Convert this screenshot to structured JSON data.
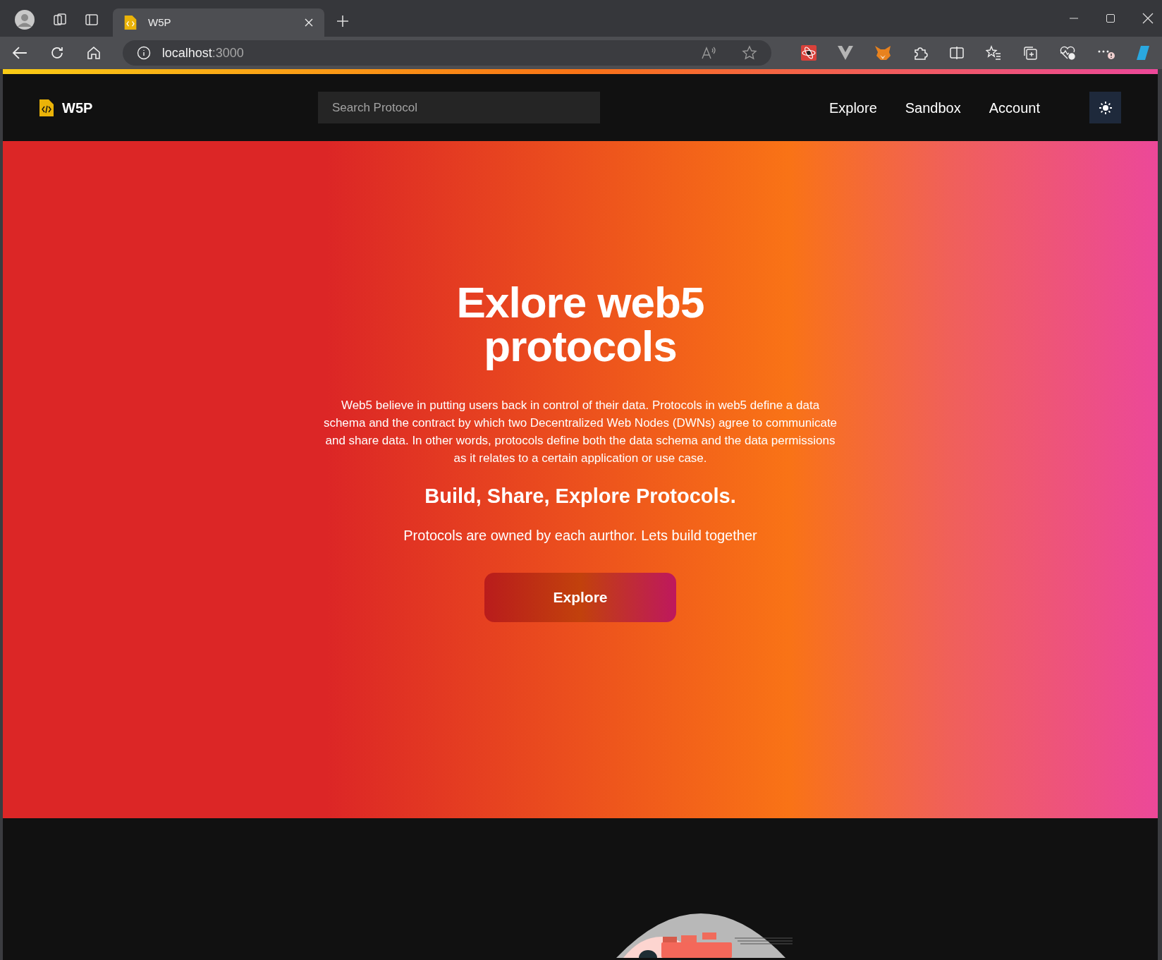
{
  "browser": {
    "tabs": [
      {
        "title": "W5P",
        "selected": true
      }
    ],
    "address": {
      "host": "localhost",
      "port": ":3000"
    }
  },
  "navbar": {
    "logo": "W5P",
    "search": {
      "placeholder": "Search Protocol"
    },
    "links": [
      {
        "label": "Explore"
      },
      {
        "label": "Sandbox"
      },
      {
        "label": "Account"
      }
    ]
  },
  "hero": {
    "title": "Exlore web5 protocols",
    "description": "Web5 believe in putting users back in control of their data. Protocols in web5 define a data schema and the contract by which two Decentralized Web Nodes (DWNs) agree to communicate and share data. In other words, protocols define both the data schema and the data permissions as it relates to a certain application or use case.",
    "subtitle": "Build, Share, Explore Protocols.",
    "tagline": "Protocols are owned by each aurthor. Lets build together",
    "button": "Explore"
  }
}
